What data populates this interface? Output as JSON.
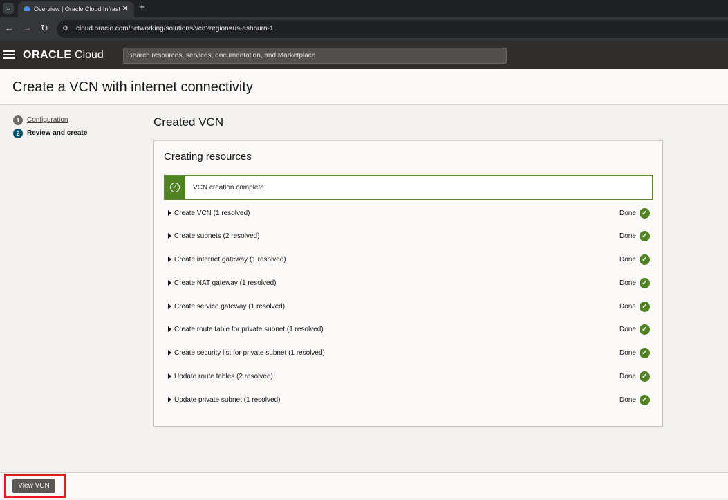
{
  "browser": {
    "tab_title": "Overview | Oracle Cloud Infrastructure",
    "tab_close": "✕",
    "new_tab": "+",
    "url": "cloud.oracle.com/networking/solutions/vcn?region=us-ashburn-1"
  },
  "header": {
    "logo_brand": "ORACLE",
    "logo_product": "Cloud",
    "search_placeholder": "Search resources, services, documentation, and Marketplace"
  },
  "page": {
    "title": "Create a VCN with internet connectivity"
  },
  "steps": [
    {
      "number": "1",
      "label": "Configuration",
      "state": "complete"
    },
    {
      "number": "2",
      "label": "Review and create",
      "state": "current"
    }
  ],
  "main": {
    "section_title": "Created VCN",
    "card_title": "Creating resources",
    "banner_text": "VCN creation complete",
    "status_color": "#508223",
    "tasks": [
      {
        "label": "Create VCN (1 resolved)",
        "status": "Done"
      },
      {
        "label": "Create subnets (2 resolved)",
        "status": "Done"
      },
      {
        "label": "Create internet gateway (1 resolved)",
        "status": "Done"
      },
      {
        "label": "Create NAT gateway (1 resolved)",
        "status": "Done"
      },
      {
        "label": "Create service gateway (1 resolved)",
        "status": "Done"
      },
      {
        "label": "Create route table for private subnet (1 resolved)",
        "status": "Done"
      },
      {
        "label": "Create security list for private subnet (1 resolved)",
        "status": "Done"
      },
      {
        "label": "Update route tables (2 resolved)",
        "status": "Done"
      },
      {
        "label": "Update private subnet (1 resolved)",
        "status": "Done"
      }
    ]
  },
  "footer": {
    "view_button": "View VCN",
    "highlight_color": "#e31b23"
  }
}
